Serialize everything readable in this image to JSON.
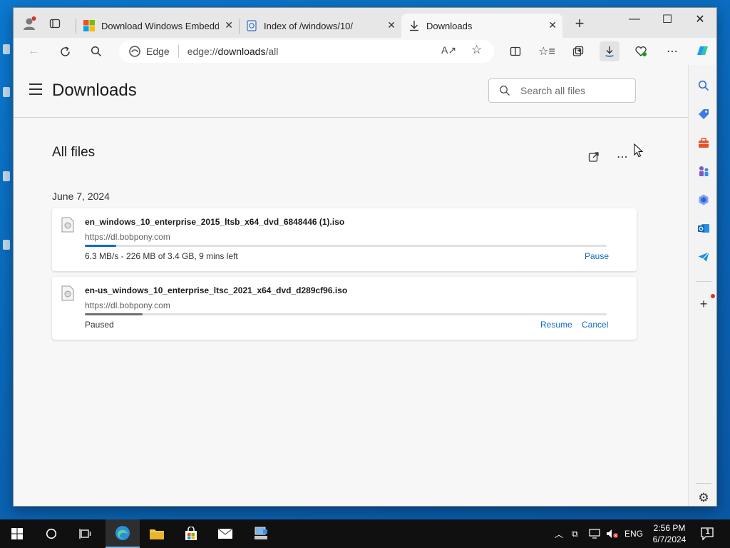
{
  "window": {
    "tabs": [
      {
        "title": "Download Windows Embedded"
      },
      {
        "title": "Index of /windows/10/"
      },
      {
        "title": "Downloads",
        "active": true
      }
    ],
    "controls": {
      "minimize": "—",
      "maximize": "☐",
      "close": "✕"
    }
  },
  "toolbar": {
    "site_label": "Edge",
    "url_prefix": "edge://",
    "url_host": "downloads",
    "url_path": "/all"
  },
  "page": {
    "title": "Downloads",
    "search_placeholder": "Search all files",
    "section_title": "All files",
    "date_group": "June 7, 2024",
    "downloads": [
      {
        "filename": "en_windows_10_enterprise_2015_ltsb_x64_dvd_6848446 (1).iso",
        "source": "https://dl.bobpony.com",
        "progress": 0.06,
        "status": "6.3 MB/s - 226 MB of 3.4 GB, 9 mins left",
        "actions": [
          "Pause"
        ]
      },
      {
        "filename": "en-us_windows_10_enterprise_ltsc_2021_x64_dvd_d289cf96.iso",
        "source": "https://dl.bobpony.com",
        "progress": 0.11,
        "status": "Paused",
        "actions": [
          "Resume",
          "Cancel"
        ]
      }
    ]
  },
  "colors": {
    "accent": "#0f6cbd",
    "progress_active": "#0f6cbd",
    "progress_paused": "#707070",
    "desktop": "#0a6fc2",
    "taskbar": "#101010"
  },
  "taskbar": {
    "language": "ENG",
    "time": "2:56 PM",
    "date": "6/7/2024",
    "notification_count": "1"
  }
}
